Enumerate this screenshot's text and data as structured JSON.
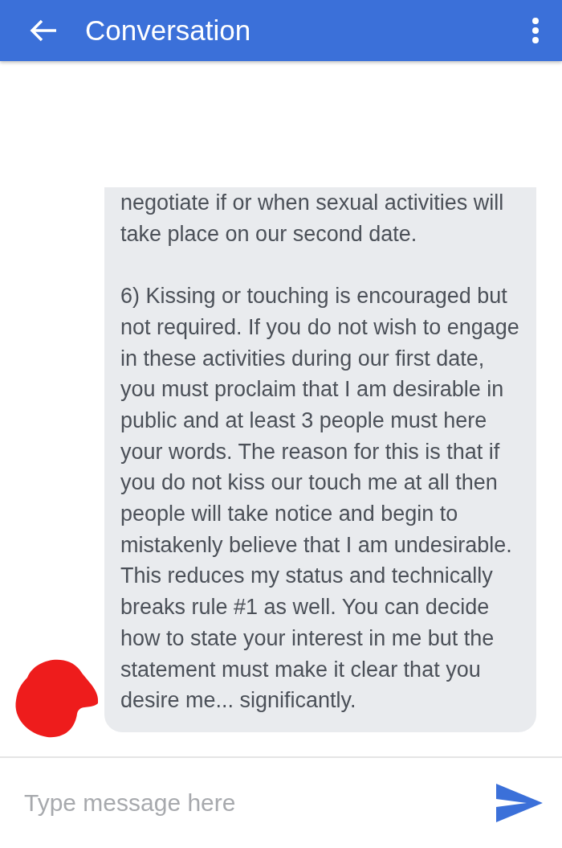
{
  "app_bar": {
    "title": "Conversation"
  },
  "message": {
    "paragraphs": [
      "negotiate if or when sexual activities will take place on our second date.",
      "6) Kissing or touching is encouraged but not required. If you do not wish to engage in these activities during our first date, you must proclaim that I am desirable in public and at least 3 people must here your words. The reason for this is that if you do not kiss our touch me at all then people will take notice and begin to mistakenly believe that I am undesirable. This reduces my status and technically breaks rule #1 as well. You can decide how to state your interest in me but the statement must make it clear that you desire me... significantly."
    ]
  },
  "composer": {
    "placeholder": "Type message here"
  }
}
